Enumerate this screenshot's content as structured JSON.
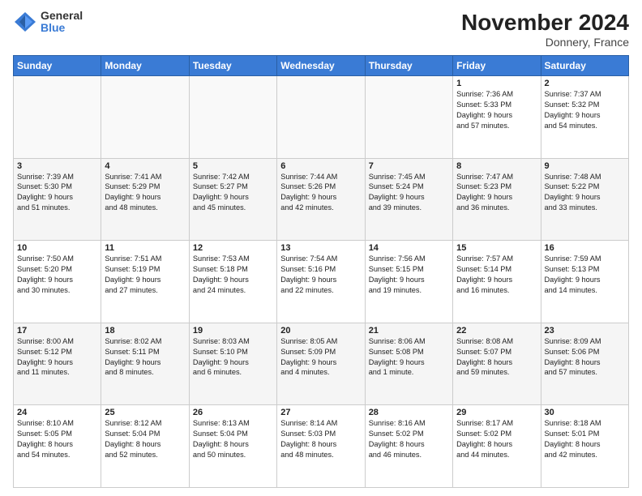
{
  "logo": {
    "general": "General",
    "blue": "Blue"
  },
  "header": {
    "month": "November 2024",
    "location": "Donnery, France"
  },
  "weekdays": [
    "Sunday",
    "Monday",
    "Tuesday",
    "Wednesday",
    "Thursday",
    "Friday",
    "Saturday"
  ],
  "weeks": [
    [
      {
        "day": "",
        "info": ""
      },
      {
        "day": "",
        "info": ""
      },
      {
        "day": "",
        "info": ""
      },
      {
        "day": "",
        "info": ""
      },
      {
        "day": "",
        "info": ""
      },
      {
        "day": "1",
        "info": "Sunrise: 7:36 AM\nSunset: 5:33 PM\nDaylight: 9 hours\nand 57 minutes."
      },
      {
        "day": "2",
        "info": "Sunrise: 7:37 AM\nSunset: 5:32 PM\nDaylight: 9 hours\nand 54 minutes."
      }
    ],
    [
      {
        "day": "3",
        "info": "Sunrise: 7:39 AM\nSunset: 5:30 PM\nDaylight: 9 hours\nand 51 minutes."
      },
      {
        "day": "4",
        "info": "Sunrise: 7:41 AM\nSunset: 5:29 PM\nDaylight: 9 hours\nand 48 minutes."
      },
      {
        "day": "5",
        "info": "Sunrise: 7:42 AM\nSunset: 5:27 PM\nDaylight: 9 hours\nand 45 minutes."
      },
      {
        "day": "6",
        "info": "Sunrise: 7:44 AM\nSunset: 5:26 PM\nDaylight: 9 hours\nand 42 minutes."
      },
      {
        "day": "7",
        "info": "Sunrise: 7:45 AM\nSunset: 5:24 PM\nDaylight: 9 hours\nand 39 minutes."
      },
      {
        "day": "8",
        "info": "Sunrise: 7:47 AM\nSunset: 5:23 PM\nDaylight: 9 hours\nand 36 minutes."
      },
      {
        "day": "9",
        "info": "Sunrise: 7:48 AM\nSunset: 5:22 PM\nDaylight: 9 hours\nand 33 minutes."
      }
    ],
    [
      {
        "day": "10",
        "info": "Sunrise: 7:50 AM\nSunset: 5:20 PM\nDaylight: 9 hours\nand 30 minutes."
      },
      {
        "day": "11",
        "info": "Sunrise: 7:51 AM\nSunset: 5:19 PM\nDaylight: 9 hours\nand 27 minutes."
      },
      {
        "day": "12",
        "info": "Sunrise: 7:53 AM\nSunset: 5:18 PM\nDaylight: 9 hours\nand 24 minutes."
      },
      {
        "day": "13",
        "info": "Sunrise: 7:54 AM\nSunset: 5:16 PM\nDaylight: 9 hours\nand 22 minutes."
      },
      {
        "day": "14",
        "info": "Sunrise: 7:56 AM\nSunset: 5:15 PM\nDaylight: 9 hours\nand 19 minutes."
      },
      {
        "day": "15",
        "info": "Sunrise: 7:57 AM\nSunset: 5:14 PM\nDaylight: 9 hours\nand 16 minutes."
      },
      {
        "day": "16",
        "info": "Sunrise: 7:59 AM\nSunset: 5:13 PM\nDaylight: 9 hours\nand 14 minutes."
      }
    ],
    [
      {
        "day": "17",
        "info": "Sunrise: 8:00 AM\nSunset: 5:12 PM\nDaylight: 9 hours\nand 11 minutes."
      },
      {
        "day": "18",
        "info": "Sunrise: 8:02 AM\nSunset: 5:11 PM\nDaylight: 9 hours\nand 8 minutes."
      },
      {
        "day": "19",
        "info": "Sunrise: 8:03 AM\nSunset: 5:10 PM\nDaylight: 9 hours\nand 6 minutes."
      },
      {
        "day": "20",
        "info": "Sunrise: 8:05 AM\nSunset: 5:09 PM\nDaylight: 9 hours\nand 4 minutes."
      },
      {
        "day": "21",
        "info": "Sunrise: 8:06 AM\nSunset: 5:08 PM\nDaylight: 9 hours\nand 1 minute."
      },
      {
        "day": "22",
        "info": "Sunrise: 8:08 AM\nSunset: 5:07 PM\nDaylight: 8 hours\nand 59 minutes."
      },
      {
        "day": "23",
        "info": "Sunrise: 8:09 AM\nSunset: 5:06 PM\nDaylight: 8 hours\nand 57 minutes."
      }
    ],
    [
      {
        "day": "24",
        "info": "Sunrise: 8:10 AM\nSunset: 5:05 PM\nDaylight: 8 hours\nand 54 minutes."
      },
      {
        "day": "25",
        "info": "Sunrise: 8:12 AM\nSunset: 5:04 PM\nDaylight: 8 hours\nand 52 minutes."
      },
      {
        "day": "26",
        "info": "Sunrise: 8:13 AM\nSunset: 5:04 PM\nDaylight: 8 hours\nand 50 minutes."
      },
      {
        "day": "27",
        "info": "Sunrise: 8:14 AM\nSunset: 5:03 PM\nDaylight: 8 hours\nand 48 minutes."
      },
      {
        "day": "28",
        "info": "Sunrise: 8:16 AM\nSunset: 5:02 PM\nDaylight: 8 hours\nand 46 minutes."
      },
      {
        "day": "29",
        "info": "Sunrise: 8:17 AM\nSunset: 5:02 PM\nDaylight: 8 hours\nand 44 minutes."
      },
      {
        "day": "30",
        "info": "Sunrise: 8:18 AM\nSunset: 5:01 PM\nDaylight: 8 hours\nand 42 minutes."
      }
    ]
  ]
}
